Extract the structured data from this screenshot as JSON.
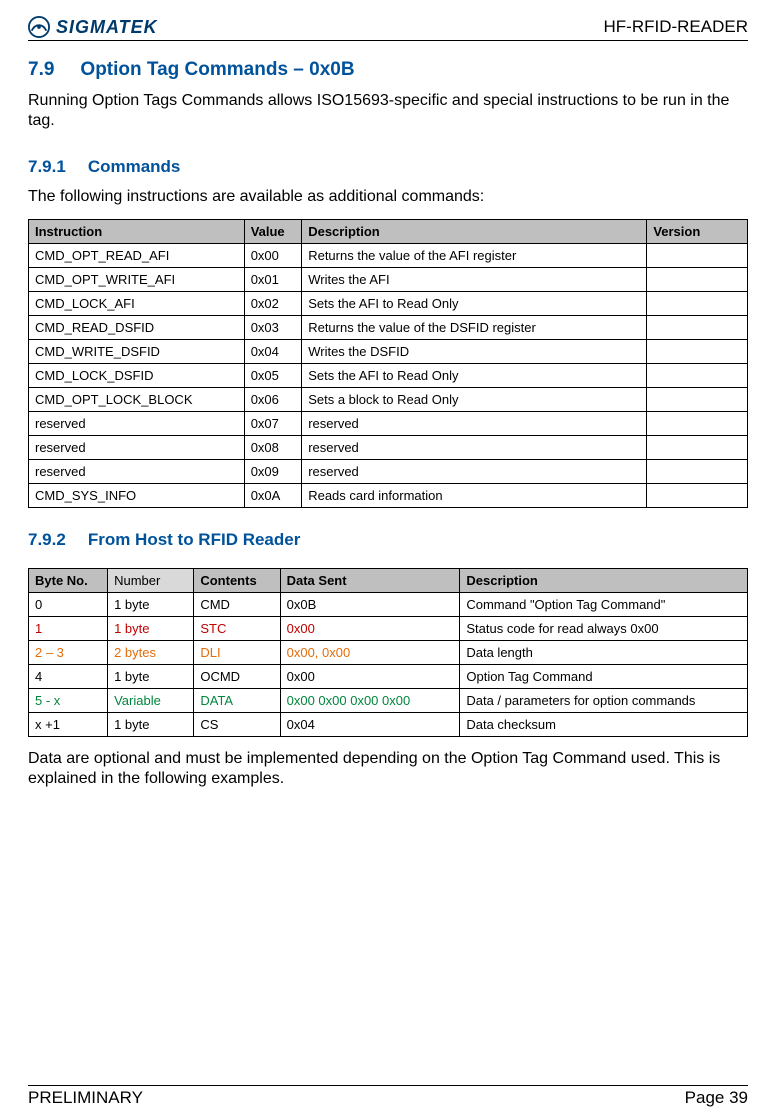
{
  "header": {
    "brand": "SIGMATEK",
    "doc_title": "HF-RFID-READER"
  },
  "section": {
    "num": "7.9",
    "title": "Option Tag Commands – 0x0B",
    "intro": "Running Option Tags Commands allows ISO15693-specific and special instructions to be run in the tag."
  },
  "sub1": {
    "num": "7.9.1",
    "title": "Commands",
    "intro": "The following instructions are available as additional commands:",
    "headers": {
      "c0": "Instruction",
      "c1": "Value",
      "c2": "Description",
      "c3": "Version"
    },
    "rows": [
      {
        "c0": "CMD_OPT_READ_AFI",
        "c1": "0x00",
        "c2": "Returns the value of the AFI register",
        "c3": ""
      },
      {
        "c0": "CMD_OPT_WRITE_AFI",
        "c1": "0x01",
        "c2": "Writes the AFI",
        "c3": ""
      },
      {
        "c0": "CMD_LOCK_AFI",
        "c1": "0x02",
        "c2": "Sets the AFI to Read Only",
        "c3": ""
      },
      {
        "c0": "CMD_READ_DSFID",
        "c1": "0x03",
        "c2": "Returns the value of the DSFID register",
        "c3": ""
      },
      {
        "c0": "CMD_WRITE_DSFID",
        "c1": "0x04",
        "c2": "Writes the DSFID",
        "c3": ""
      },
      {
        "c0": "CMD_LOCK_DSFID",
        "c1": "0x05",
        "c2": "Sets the AFI to Read Only",
        "c3": ""
      },
      {
        "c0": "CMD_OPT_LOCK_BLOCK",
        "c1": "0x06",
        "c2": "Sets a block to Read Only",
        "c3": ""
      },
      {
        "c0": "reserved",
        "c1": "0x07",
        "c2": "reserved",
        "c3": ""
      },
      {
        "c0": "reserved",
        "c1": "0x08",
        "c2": "reserved",
        "c3": ""
      },
      {
        "c0": "reserved",
        "c1": "0x09",
        "c2": "reserved",
        "c3": ""
      },
      {
        "c0": "CMD_SYS_INFO",
        "c1": "0x0A",
        "c2": "Reads card information",
        "c3": ""
      }
    ]
  },
  "sub2": {
    "num": "7.9.2",
    "title": "From Host to RFID Reader",
    "headers": {
      "c0": "Byte No.",
      "c1": "Number",
      "c2": "Contents",
      "c3": "Data Sent",
      "c4": "Description"
    },
    "rows": [
      {
        "cls": "",
        "c0": "0",
        "c1": "1 byte",
        "c2": "CMD",
        "c3": "0x0B",
        "c4": "Command \"Option Tag Command\""
      },
      {
        "cls": "row-red",
        "c0": "1",
        "c1": "1 byte",
        "c2": "STC",
        "c3": "0x00",
        "c4": "Status code for read always 0x00"
      },
      {
        "cls": "row-orange",
        "c0": "2 – 3",
        "c1": "2 bytes",
        "c2": "DLI",
        "c3": "0x00, 0x00",
        "c4": "Data length"
      },
      {
        "cls": "",
        "c0": "4",
        "c1": "1 byte",
        "c2": "OCMD",
        "c3": "0x00",
        "c4": "Option Tag Command"
      },
      {
        "cls": "row-green",
        "c0": "5 - x",
        "c1": "Variable",
        "c2": "DATA",
        "c3": "0x00 0x00 0x00 0x00",
        "c4": "Data / parameters for option commands"
      },
      {
        "cls": "",
        "c0": "x +1",
        "c1": "1 byte",
        "c2": "CS",
        "c3": "0x04",
        "c4": "Data checksum"
      }
    ],
    "outro": "Data are optional and must be implemented depending on the Option Tag Command used. This is explained in the following examples."
  },
  "footer": {
    "left": "PRELIMINARY",
    "right": "Page 39"
  }
}
